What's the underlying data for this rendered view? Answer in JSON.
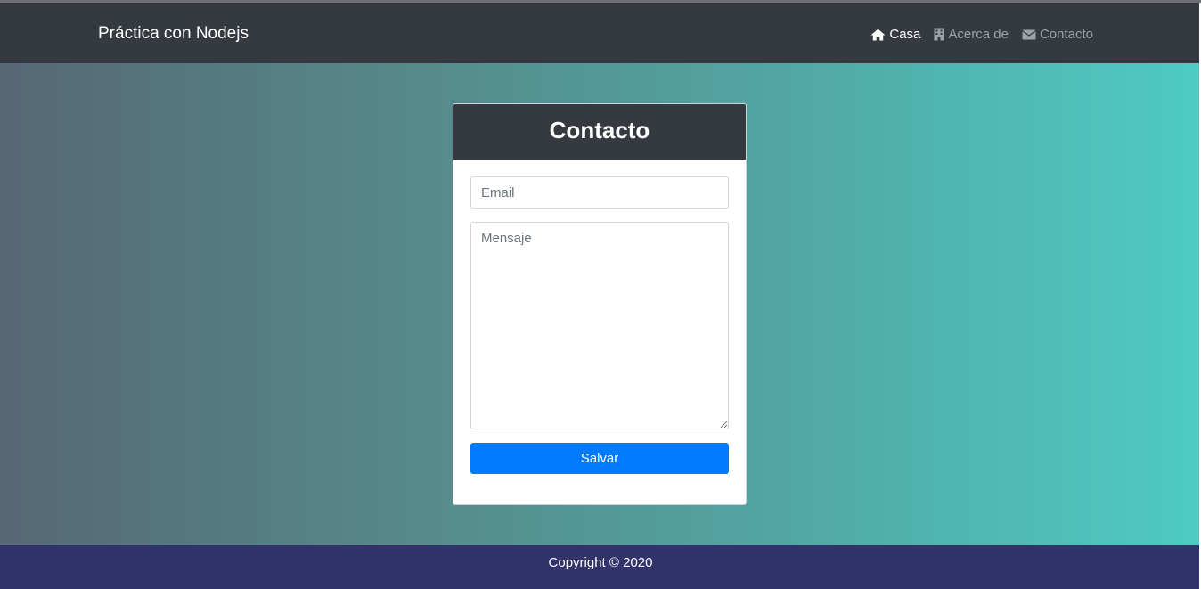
{
  "navbar": {
    "brand": "Práctica con Nodejs",
    "links": [
      {
        "label": "Casa",
        "icon": "home-icon",
        "active": true
      },
      {
        "label": "Acerca de",
        "icon": "building-icon",
        "active": false
      },
      {
        "label": "Contacto",
        "icon": "envelope-icon",
        "active": false
      }
    ]
  },
  "card": {
    "title": "Contacto",
    "email_placeholder": "Email",
    "message_placeholder": "Mensaje",
    "save_label": "Salvar"
  },
  "footer": {
    "copyright": "Copyright © 2020"
  },
  "colors": {
    "navbar_bg": "#343a40",
    "button_primary": "#007bff",
    "footer_bg": "#33336b",
    "gradient_start": "#566776",
    "gradient_end": "#4ecbc2"
  }
}
